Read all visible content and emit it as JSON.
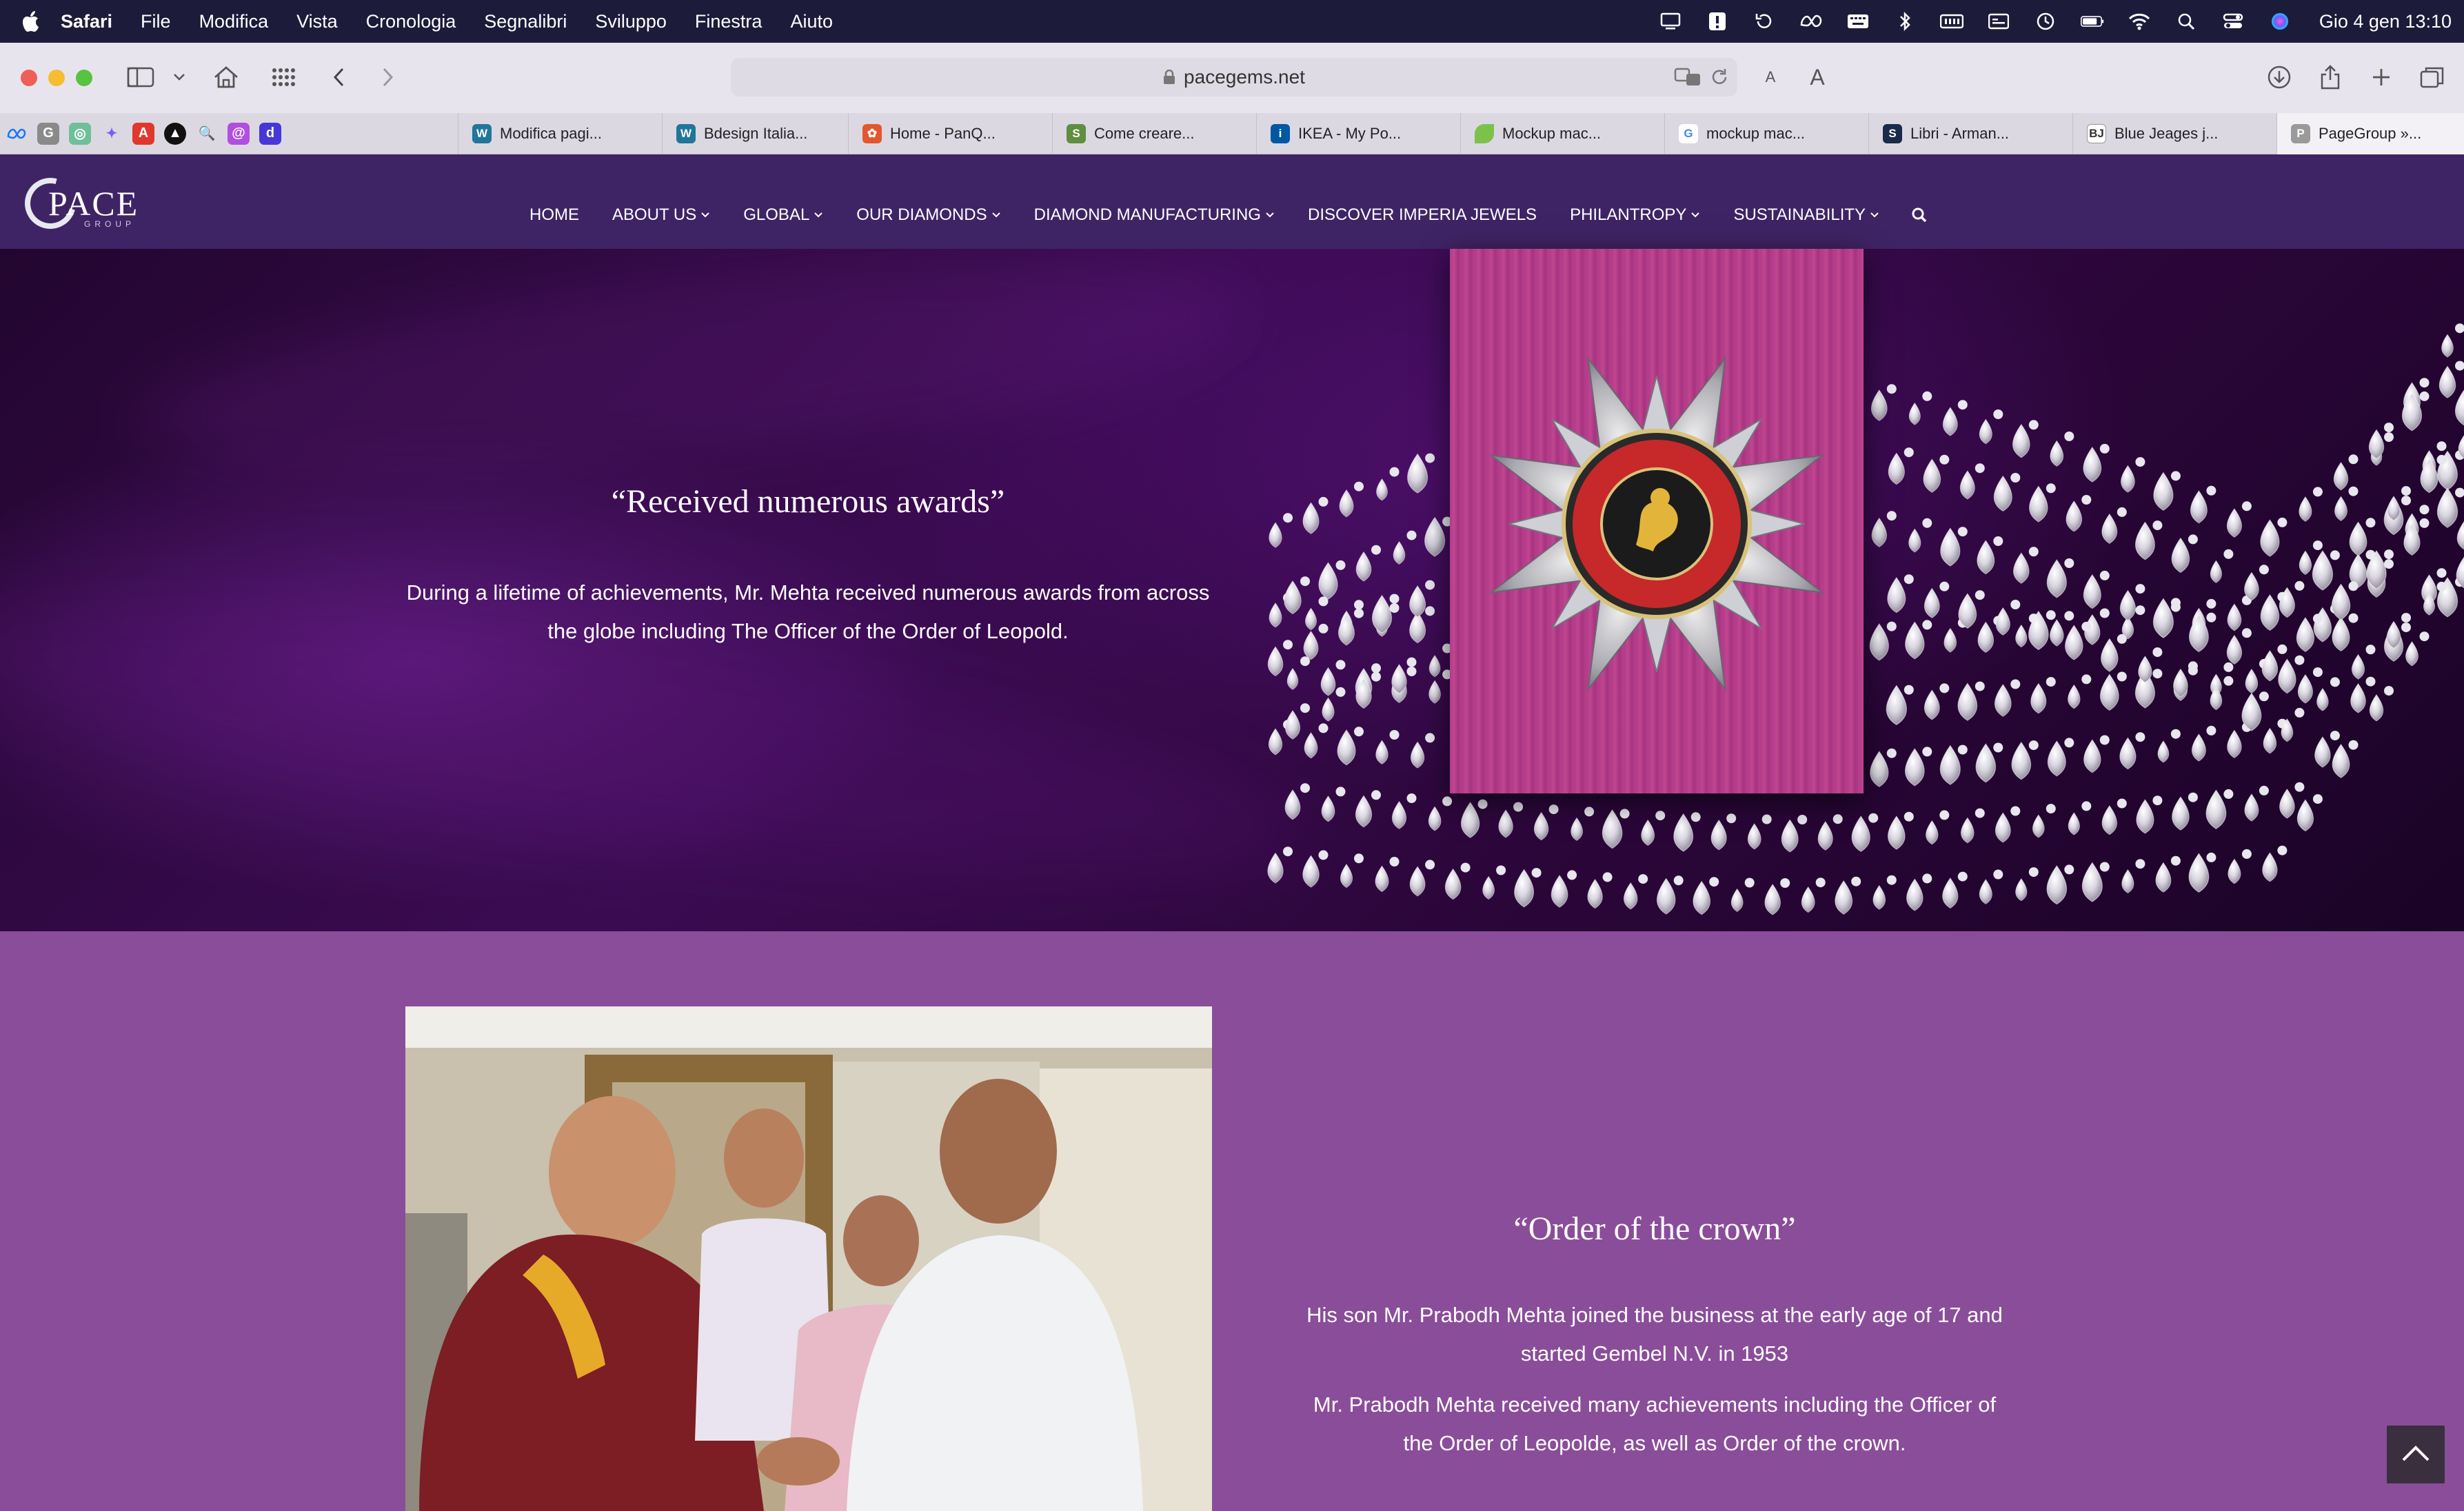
{
  "menubar": {
    "app": "Safari",
    "items": [
      "File",
      "Modifica",
      "Vista",
      "Cronologia",
      "Segnalibri",
      "Sviluppo",
      "Finestra",
      "Aiuto"
    ],
    "clock": "Gio 4 gen  13:10"
  },
  "browser": {
    "url": "pacegems.net",
    "text_small": "A",
    "text_large": "A"
  },
  "tabs": [
    {
      "label": "Modifica pagi...",
      "icon": "wordpress-icon"
    },
    {
      "label": "Bdesign Italia...",
      "icon": "wordpress-icon"
    },
    {
      "label": "Home - PanQ...",
      "icon": "panq-icon"
    },
    {
      "label": "Come creare...",
      "icon": "shopify-icon"
    },
    {
      "label": "IKEA - My Po...",
      "icon": "ikea-icon"
    },
    {
      "label": "Mockup mac...",
      "icon": "leaf-icon"
    },
    {
      "label": "mockup mac...",
      "icon": "google-icon"
    },
    {
      "label": "Libri - Arman...",
      "icon": "libri-icon"
    },
    {
      "label": "Blue Jeages j...",
      "icon": "bj-icon"
    },
    {
      "label": "PageGroup »...",
      "icon": "p-icon"
    }
  ],
  "site": {
    "logo_word": "PACE",
    "logo_sub": "GROUP",
    "nav": [
      {
        "label": "HOME",
        "dropdown": false
      },
      {
        "label": "ABOUT US",
        "dropdown": true
      },
      {
        "label": "GLOBAL",
        "dropdown": true
      },
      {
        "label": "OUR DIAMONDS",
        "dropdown": true
      },
      {
        "label": "DIAMOND MANUFACTURING",
        "dropdown": true
      },
      {
        "label": "DISCOVER IMPERIA JEWELS",
        "dropdown": false
      },
      {
        "label": "PHILANTROPY",
        "dropdown": true
      },
      {
        "label": "SUSTAINABILITY",
        "dropdown": true
      }
    ]
  },
  "hero": {
    "title": "“Received numerous awards”",
    "text": "During a lifetime of achievements, Mr. Mehta received numerous awards from across the globe including The Officer of the Order of Leopold."
  },
  "section2": {
    "title": "“Order of the crown”",
    "p1": "His son Mr. Prabodh Mehta joined the business at the early age of 17 and started Gembel N.V. in 1953",
    "p2": "Mr. Prabodh Mehta received many achievements including the Officer of the Order of Leopolde, as well as Order of the crown."
  },
  "colors": {
    "menubar": "#1d1b3a",
    "site_header": "#3f2465",
    "section2_bg": "#8a4d9a",
    "ribbon": "#b23a8a"
  }
}
